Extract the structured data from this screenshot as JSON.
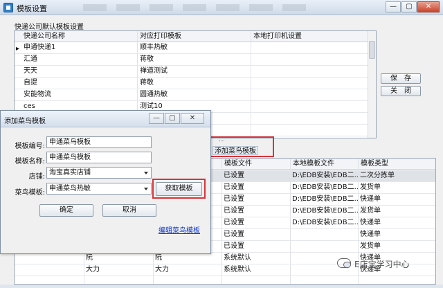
{
  "window": {
    "title": "模板设置",
    "min_glyph": "—",
    "max_glyph": "▢",
    "close_glyph": "✕"
  },
  "top_section": {
    "group_title": "快递公司默认模板设置",
    "columns": [
      "快递公司名称",
      "对应打印模板",
      "本地打印机设置"
    ],
    "row_marker": "▸",
    "rows": [
      [
        "申通快递1",
        "顺丰热敏"
      ],
      [
        "汇通",
        "蒋敬"
      ],
      [
        "天天",
        "禅道测试"
      ],
      [
        "自提",
        "蒋敬"
      ],
      [
        "安能物流",
        "圆通热敏"
      ],
      [
        "ces",
        "测试10"
      ],
      [
        "",
        ""
      ],
      [
        "",
        ""
      ]
    ]
  },
  "buttons": {
    "save": "保　存",
    "close": "关　闭"
  },
  "add_bar": {
    "label": "添加菜鸟模板"
  },
  "bottom_section": {
    "columns": [
      "",
      "",
      "",
      "模板文件",
      "本地模板文件",
      "模板类型"
    ],
    "rows": [
      [
        "",
        "",
        "",
        "已设置",
        "D:\\EDB安装\\EDB二...",
        "二次分拣单"
      ],
      [
        "",
        "",
        "",
        "已设置",
        "D:\\EDB安装\\EDB二...",
        "发货单"
      ],
      [
        "",
        "",
        "",
        "已设置",
        "D:\\EDB安装\\EDB二...",
        "快递单"
      ],
      [
        "",
        "",
        "",
        "已设置",
        "D:\\EDB安装\\EDB二...",
        "发货单"
      ],
      [
        "",
        "",
        "",
        "已设置",
        "D:\\EDB安装\\EDB二...",
        "快递单"
      ],
      [
        "",
        "",
        "",
        "已设置",
        "",
        "快递单"
      ],
      [
        "",
        "",
        "",
        "已设置",
        "",
        "发货单"
      ],
      [
        "",
        "阮",
        "阮",
        "系统默认",
        "",
        "快递单"
      ],
      [
        "",
        "大力",
        "大力",
        "系统默认",
        "",
        "快递单"
      ],
      [
        "",
        "",
        "",
        "",
        "",
        ""
      ]
    ]
  },
  "dialog": {
    "title": "添加菜鸟模板",
    "fields": {
      "template_no_label": "模板编号:",
      "template_no_value": "申通菜鸟模板",
      "template_name_label": "模板名称:",
      "template_name_value": "申通菜鸟模板",
      "store_label": "店铺:",
      "store_value": "淘宝真实店铺",
      "cainiao_label": "菜鸟模板:",
      "cainiao_value": "申通菜鸟热敏"
    },
    "fetch_button": "获取模板",
    "ok_button": "确定",
    "cancel_button": "取消",
    "edit_link": "编辑菜鸟模板"
  },
  "watermark": {
    "text": "E店宝学习中心"
  },
  "colors": {
    "highlight": "#d8333a",
    "link": "#0a33cc",
    "selected_row": "#dfe3e8"
  }
}
